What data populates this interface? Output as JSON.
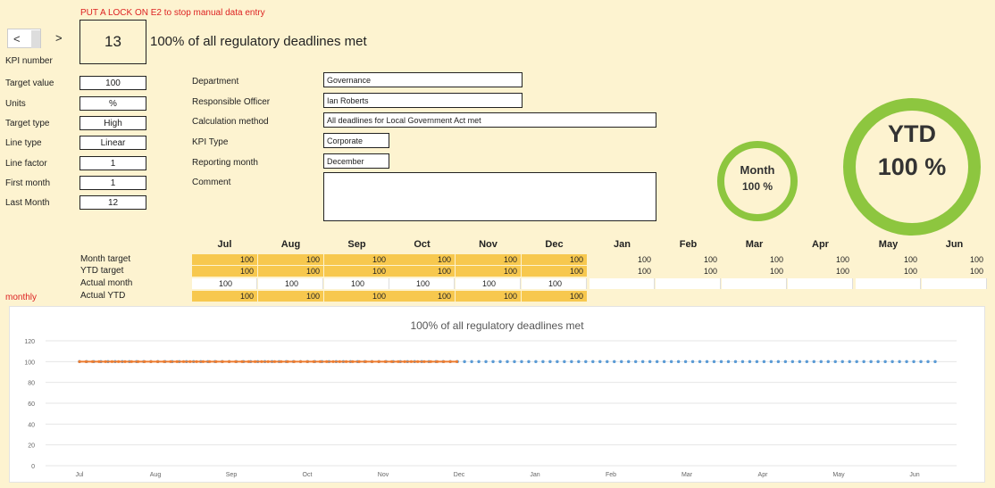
{
  "warning": "PUT A LOCK ON E2 to stop manual data entry",
  "nav": {
    "prev": "<",
    "next": ">"
  },
  "kpi": {
    "number_label": "KPI number",
    "number": "13",
    "title": "100% of all regulatory deadlines met"
  },
  "left_fields": [
    {
      "label": "Target value",
      "value": "100"
    },
    {
      "label": "Units",
      "value": "%"
    },
    {
      "label": "Target type",
      "value": "High"
    },
    {
      "label": "Line type",
      "value": "Linear"
    },
    {
      "label": "Line factor",
      "value": "1"
    },
    {
      "label": "First month",
      "value": "1"
    },
    {
      "label": "Last Month",
      "value": "12"
    }
  ],
  "mid_fields": [
    {
      "label": "Department",
      "value": "Governance"
    },
    {
      "label": "Responsible Officer",
      "value": "Ian Roberts"
    },
    {
      "label": "Calculation method",
      "value": "All deadlines for Local Government Act met"
    },
    {
      "label": "KPI Type",
      "value": "Corporate"
    },
    {
      "label": "Reporting month",
      "value": "December"
    },
    {
      "label": "Comment",
      "value": ""
    }
  ],
  "gauges": {
    "month": {
      "label": "Month",
      "value": "100 %"
    },
    "ytd": {
      "label": "YTD",
      "value": "100 %"
    }
  },
  "months": [
    "Jul",
    "Aug",
    "Sep",
    "Oct",
    "Nov",
    "Dec",
    "Jan",
    "Feb",
    "Mar",
    "Apr",
    "May",
    "Jun"
  ],
  "table": {
    "side_label": "monthly",
    "rows": [
      {
        "label": "Month target",
        "values": [
          "100",
          "100",
          "100",
          "100",
          "100",
          "100",
          "100",
          "100",
          "100",
          "100",
          "100",
          "100"
        ]
      },
      {
        "label": "YTD target",
        "values": [
          "100",
          "100",
          "100",
          "100",
          "100",
          "100",
          "100",
          "100",
          "100",
          "100",
          "100",
          "100"
        ]
      },
      {
        "label": "Actual month",
        "values": [
          "100",
          "100",
          "100",
          "100",
          "100",
          "100",
          "",
          "",
          "",
          "",
          "",
          ""
        ]
      },
      {
        "label": "Actual YTD",
        "values": [
          "100",
          "100",
          "100",
          "100",
          "100",
          "100",
          "",
          "",
          "",
          "",
          "",
          ""
        ]
      }
    ]
  },
  "colors": {
    "background": "#fdf3d0",
    "highlight": "#f7c84e",
    "gauge": "#8dc63f",
    "warning": "#dd2222",
    "actual_line": "#ed7d31",
    "target_line": "#5b9bd5"
  },
  "chart_data": {
    "type": "line",
    "title": "100% of all regulatory deadlines met",
    "categories": [
      "Jul",
      "Aug",
      "Sep",
      "Oct",
      "Nov",
      "Dec",
      "Jan",
      "Feb",
      "Mar",
      "Apr",
      "May",
      "Jun"
    ],
    "series": [
      {
        "values": [
          100,
          100,
          100,
          100,
          100,
          100,
          100,
          100,
          100,
          100,
          100,
          100
        ],
        "style": "dotted",
        "color": "#5b9bd5"
      },
      {
        "values": [
          100,
          100,
          100,
          100,
          100,
          100
        ],
        "style": "solid",
        "color": "#ed7d31"
      }
    ],
    "ylim": [
      0,
      120
    ],
    "yticks": [
      0,
      20,
      40,
      60,
      80,
      100,
      120
    ],
    "grid": true
  }
}
